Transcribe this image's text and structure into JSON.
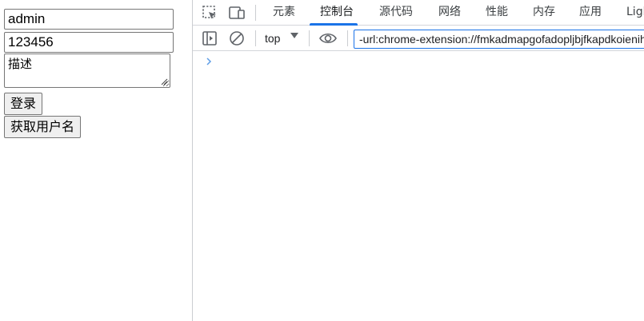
{
  "page": {
    "username_value": "admin",
    "password_value": "123456",
    "description_value": "描述",
    "login_button": "登录",
    "get_username_button": "获取用户名"
  },
  "devtools": {
    "tabs": [
      {
        "label": "元素",
        "active": false
      },
      {
        "label": "控制台",
        "active": true
      },
      {
        "label": "源代码",
        "active": false
      },
      {
        "label": "网络",
        "active": false
      },
      {
        "label": "性能",
        "active": false
      },
      {
        "label": "内存",
        "active": false
      },
      {
        "label": "应用",
        "active": false
      },
      {
        "label": "Ligh",
        "active": false
      }
    ],
    "context": "top",
    "filter_value": "-url:chrome-extension://fmkadmapgofadopljbjfkapdkoienihi",
    "accent_color": "#1a73e8"
  }
}
